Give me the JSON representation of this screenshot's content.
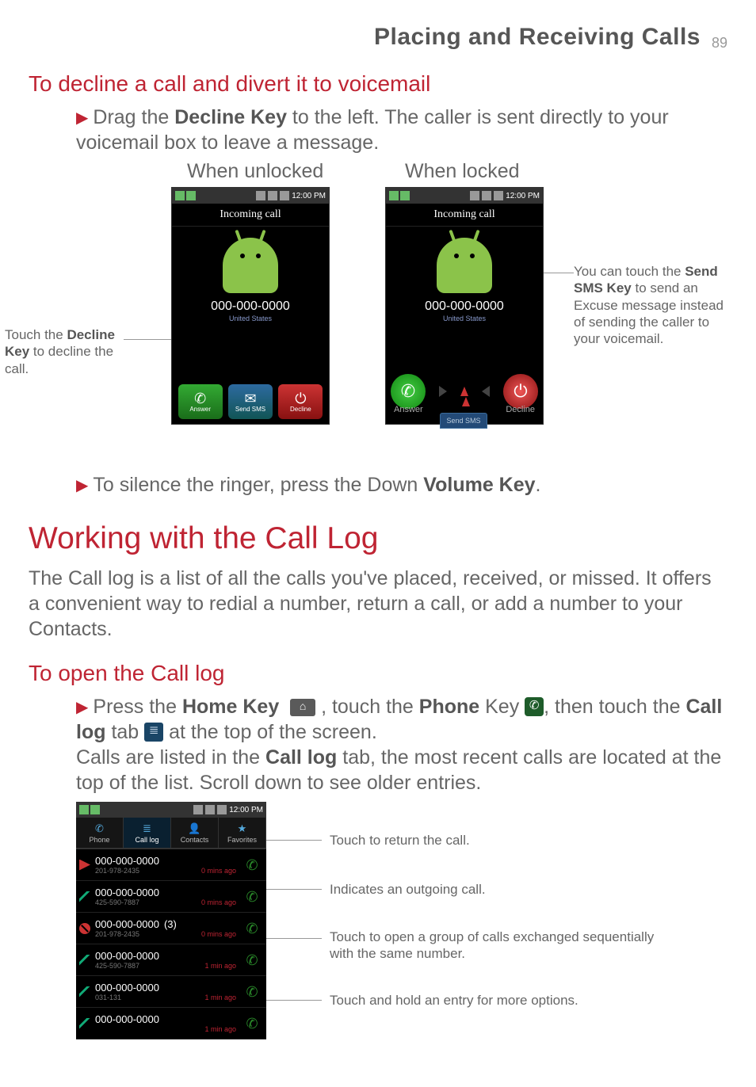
{
  "header": {
    "title": "Placing and Receiving Calls",
    "page": "89"
  },
  "s1": {
    "heading": "To decline a call and divert it to voicemail",
    "bullet": "Drag the ",
    "bullet_kb": "Decline Key",
    "bullet2": " to the left. The caller is sent directly to your voicemail box to leave a message.",
    "label_unlocked": "When unlocked",
    "label_locked": "When locked",
    "callout_left_a": "Touch the ",
    "callout_left_b": "Decline Key",
    "callout_left_c": " to decline the call.",
    "callout_right_a": "You can touch the ",
    "callout_right_b": "Send SMS Key",
    "callout_right_c": " to send an Excuse message instead of sending the caller to your voicemail.",
    "bullet_silence_a": "To silence the ringer, press the Down ",
    "bullet_silence_b": "Volume Key",
    "bullet_silence_c": "."
  },
  "mock": {
    "time": "12:00 PM",
    "incoming": "Incoming call",
    "number": "000-000-0000",
    "loc": "United States",
    "answer": "Answer",
    "sendsms": "Send SMS",
    "decline": "Decline",
    "sms_pill": "Send SMS"
  },
  "s2": {
    "heading": "Working with the Call Log",
    "para": "The Call log is a list of all the calls you've placed, received, or missed. It offers a convenient way to redial a number, return a call, or add a number to your Contacts."
  },
  "s3": {
    "heading": "To open the Call log",
    "line1_a": "Press the ",
    "line1_b": "Home Key",
    "line1_c": " , touch the ",
    "line1_d": "Phone",
    "line1_e": " Key ",
    "line1_f": ", then touch the ",
    "line1_g": "Call log",
    "line1_h": " tab ",
    "line1_i": " at the top of the screen.",
    "line2_a": "Calls are listed in the ",
    "line2_b": "Call log",
    "line2_c": " tab, the most recent calls are located at the top of the list. Scroll down to see older entries."
  },
  "log": {
    "time": "12:00 PM",
    "tabs": {
      "phone": "Phone",
      "calllog": "Call log",
      "contacts": "Contacts",
      "fav": "Favorites"
    },
    "rows": [
      {
        "dir": "miss",
        "num": "000-000-0000",
        "sub": "201-978-2435",
        "ago": "0 mins ago"
      },
      {
        "dir": "out",
        "num": "000-000-0000",
        "sub": "425-590-7887",
        "ago": "0 mins ago"
      },
      {
        "dir": "rej",
        "num": "000-000-0000",
        "cnt": "(3)",
        "sub": "201-978-2435",
        "ago": "0 mins ago"
      },
      {
        "dir": "out",
        "num": "000-000-0000",
        "sub": "425-590-7887",
        "ago": "1 min ago"
      },
      {
        "dir": "out",
        "num": "000-000-0000",
        "sub": "031-131",
        "ago": "1 min ago"
      },
      {
        "dir": "out",
        "num": "000-000-0000",
        "sub": "",
        "ago": "1 min ago"
      }
    ],
    "callouts": {
      "c1": "Touch to return the call.",
      "c2": "Indicates an outgoing call.",
      "c3": "Touch to open a group of calls exchanged sequentially with the same number.",
      "c4": "Touch and hold an entry for more options."
    }
  }
}
